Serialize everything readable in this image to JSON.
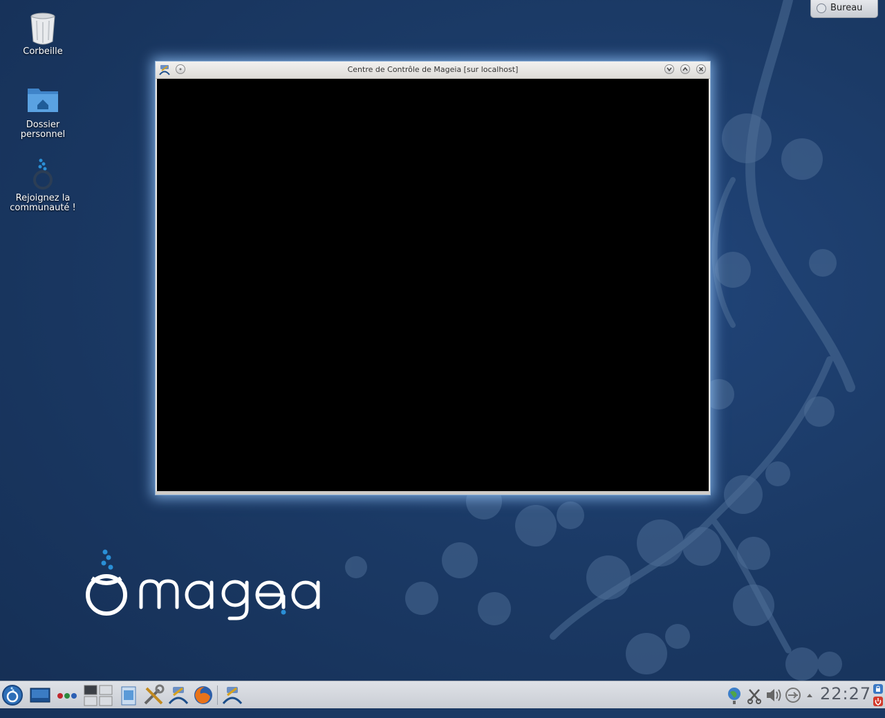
{
  "desktop": {
    "icons": [
      {
        "label": "Corbeille",
        "icon": "trash-icon"
      },
      {
        "label": "Dossier\npersonnel",
        "icon": "home-folder-icon"
      },
      {
        "label": "Rejoignez la\ncommunauté !",
        "icon": "mageia-community-icon"
      }
    ]
  },
  "activity_button": {
    "label": "Bureau",
    "icon": "activity-icon"
  },
  "window": {
    "title": "Centre de Contrôle de Mageia  [sur localhost]"
  },
  "logo": {
    "text": "mageia"
  },
  "taskbar": {
    "launchers": [
      "mageia-menu-icon",
      "show-desktop-icon",
      "activity-dots-icon",
      "pager-icon",
      "file-manager-icon",
      "tools-icon",
      "control-center-icon",
      "firefox-icon"
    ],
    "tasks": [
      "control-center-task-icon"
    ],
    "tray": [
      "network-icon",
      "clipboard-icon",
      "volume-icon",
      "usb-icon",
      "expand-tray-icon"
    ],
    "clock": "22:27"
  },
  "colors": {
    "desktop_bg": "#1b3a66",
    "mageia_blue": "#2a8fd6",
    "taskbar_bg": "#d6d9de"
  }
}
